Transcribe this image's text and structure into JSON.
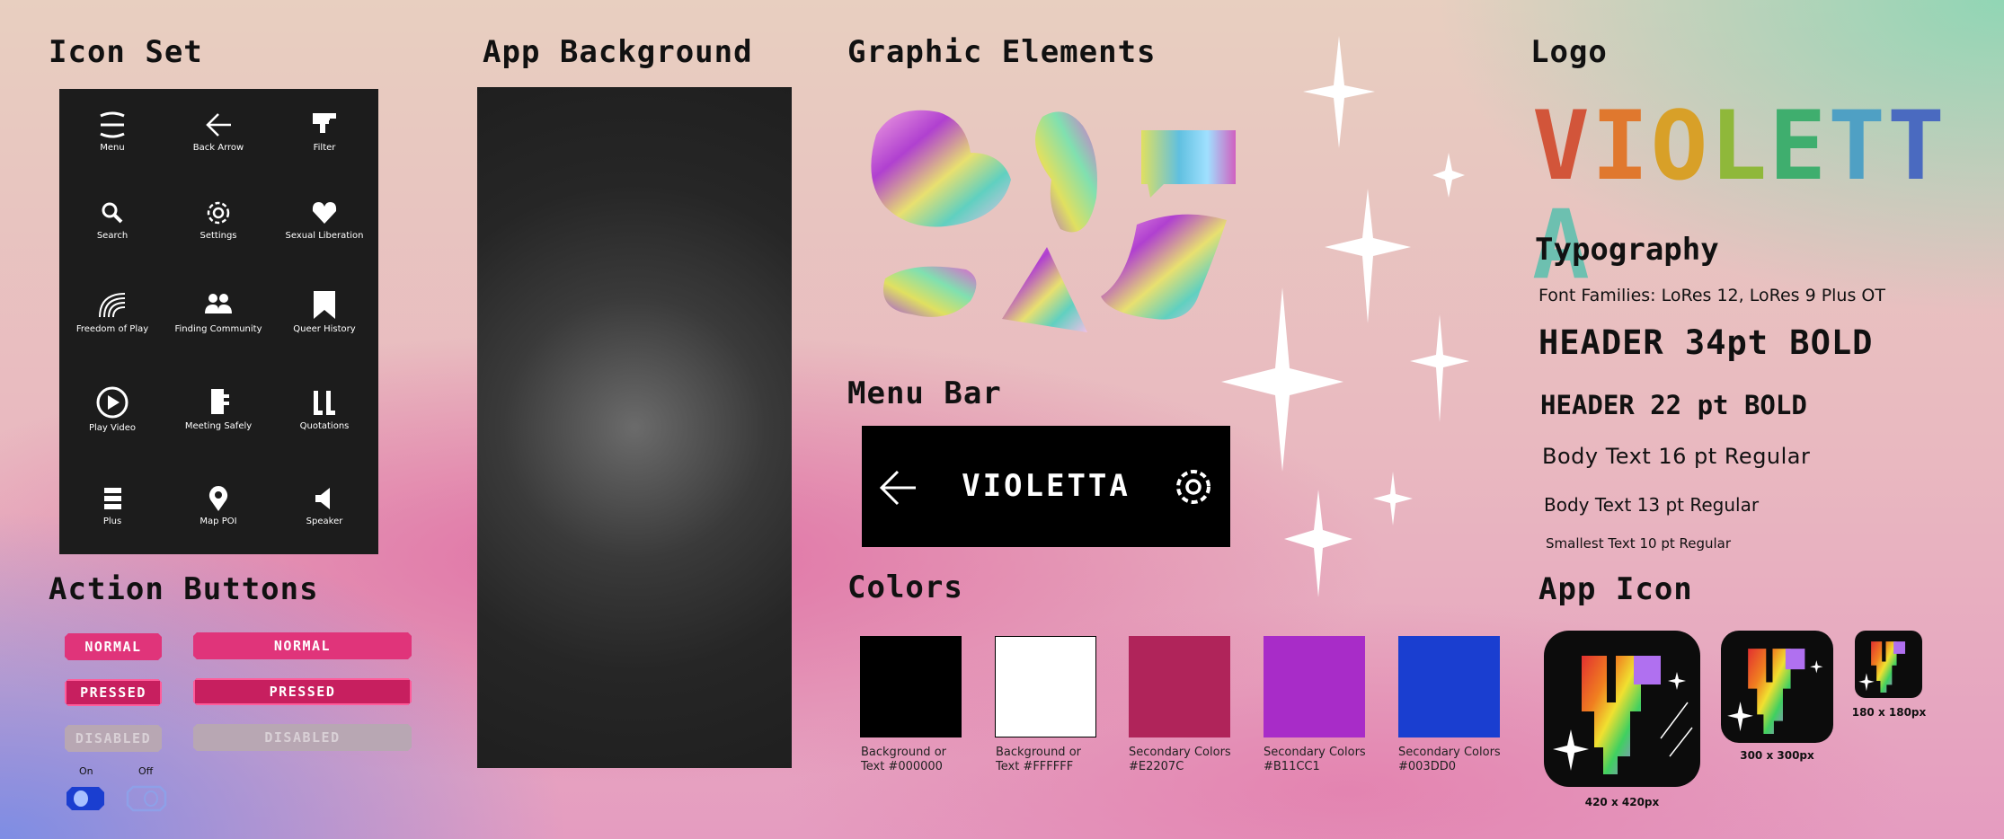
{
  "sections": {
    "icon_set": "Icon Set",
    "app_background": "App Background",
    "graphic_elements": "Graphic Elements",
    "logo": "Logo",
    "menu_bar": "Menu Bar",
    "colors": "Colors",
    "action_buttons": "Action Buttons",
    "app_icon": "App Icon"
  },
  "icons": [
    {
      "label": "Menu",
      "icon": "menu-icon"
    },
    {
      "label": "Back Arrow",
      "icon": "back-arrow-icon"
    },
    {
      "label": "Filter",
      "icon": "filter-icon"
    },
    {
      "label": "Search",
      "icon": "search-icon"
    },
    {
      "label": "Settings",
      "icon": "settings-icon"
    },
    {
      "label": "Sexual Liberation",
      "icon": "heart-icon"
    },
    {
      "label": "Freedom of Play",
      "icon": "rainbow-icon"
    },
    {
      "label": "Finding Community",
      "icon": "community-icon"
    },
    {
      "label": "Queer History",
      "icon": "bookmark-icon"
    },
    {
      "label": "Play Video",
      "icon": "play-video-icon"
    },
    {
      "label": "Meeting Safely",
      "icon": "hand-icon"
    },
    {
      "label": "Quotations",
      "icon": "quotations-icon"
    },
    {
      "label": "Plus",
      "icon": "plus-icon"
    },
    {
      "label": "Map POI",
      "icon": "map-poi-icon"
    },
    {
      "label": "Speaker",
      "icon": "speaker-icon"
    }
  ],
  "action_buttons": {
    "normal": "NORMAL",
    "pressed": "PRESSED",
    "disabled": "DISABLED",
    "toggle_on": "On",
    "toggle_off": "Off"
  },
  "menu_bar": {
    "title": "VIOLETTA"
  },
  "colors": [
    {
      "label_line1": "Background or",
      "label_line2": "Text #000000",
      "hex": "#000000"
    },
    {
      "label_line1": "Background or",
      "label_line2": "Text #FFFFFF",
      "hex": "#FFFFFF"
    },
    {
      "label_line1": "Secondary Colors",
      "label_line2": "#E2207C",
      "hex": "#B0245A"
    },
    {
      "label_line1": "Secondary Colors",
      "label_line2": "#B11CC1",
      "hex": "#A82CC8"
    },
    {
      "label_line1": "Secondary Colors",
      "label_line2": "#003DD0",
      "hex": "#1A3ED0"
    }
  ],
  "logo": {
    "text": "VIOLETTA",
    "letter_colors": [
      "#d2553a",
      "#e0782e",
      "#d8a028",
      "#8fb83a",
      "#3fae6e",
      "#4fa0c4",
      "#4a6ac0",
      "#6dc0b0"
    ]
  },
  "typography": {
    "title": "Typography",
    "families": "Font Families: LoRes 12, LoRes 9 Plus OT",
    "h34": "HEADER 34pt BOLD",
    "h22": "HEADER 22 pt BOLD",
    "b16": "Body Text 16 pt Regular",
    "b13": "Body Text 13 pt Regular",
    "s10": "Smallest Text 10 pt Regular"
  },
  "app_icons": [
    {
      "label": "420 x 420px"
    },
    {
      "label": "300 x 300px"
    },
    {
      "label": "180 x 180px"
    }
  ]
}
